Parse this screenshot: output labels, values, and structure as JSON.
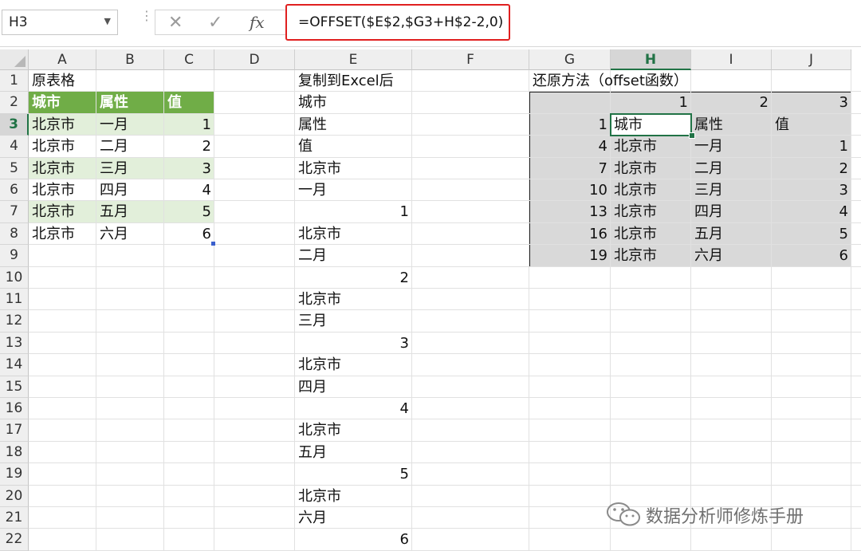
{
  "formula_bar": {
    "name_box": "H3",
    "cancel_icon": "✕",
    "enter_icon": "✓",
    "fx_label": "fx",
    "formula": "=OFFSET($E$2,$G3+H$2-2,0)"
  },
  "columns": [
    "A",
    "B",
    "C",
    "D",
    "E",
    "F",
    "G",
    "H",
    "I",
    "J"
  ],
  "rows": [
    "1",
    "2",
    "3",
    "4",
    "5",
    "6",
    "7",
    "8",
    "9",
    "10",
    "11",
    "12",
    "13",
    "14",
    "15",
    "16",
    "17",
    "18",
    "19",
    "20",
    "21",
    "22"
  ],
  "sheet": {
    "A1": "原表格",
    "A2": "城市",
    "B2": "属性",
    "C2": "值",
    "A3": "北京市",
    "B3": "一月",
    "C3": "1",
    "A4": "北京市",
    "B4": "二月",
    "C4": "2",
    "A5": "北京市",
    "B5": "三月",
    "C5": "3",
    "A6": "北京市",
    "B6": "四月",
    "C6": "4",
    "A7": "北京市",
    "B7": "五月",
    "C7": "5",
    "A8": "北京市",
    "B8": "六月",
    "C8": "6",
    "E1": "复制到Excel后",
    "E2": "城市",
    "E3": "属性",
    "E4": "值",
    "E5": "北京市",
    "E6": "一月",
    "E7": "1",
    "E8": "北京市",
    "E9": "二月",
    "E10": "2",
    "E11": "北京市",
    "E12": "三月",
    "E13": "3",
    "E14": "北京市",
    "E15": "四月",
    "E16": "4",
    "E17": "北京市",
    "E18": "五月",
    "E19": "5",
    "E20": "北京市",
    "E21": "六月",
    "E22": "6",
    "G1": "还原方法（offset函数）",
    "H2": "1",
    "I2": "2",
    "J2": "3",
    "G3": "1",
    "H3": "城市",
    "I3": "属性",
    "J3": "值",
    "G4": "4",
    "H4": "北京市",
    "I4": "一月",
    "J4": "1",
    "G5": "7",
    "H5": "北京市",
    "I5": "二月",
    "J5": "2",
    "G6": "10",
    "H6": "北京市",
    "I6": "三月",
    "J6": "3",
    "G7": "13",
    "H7": "北京市",
    "I7": "四月",
    "J7": "4",
    "G8": "16",
    "H8": "北京市",
    "I8": "五月",
    "J8": "5",
    "G9": "19",
    "H9": "北京市",
    "I9": "六月",
    "J9": "6"
  },
  "active_cell": "H3",
  "colors": {
    "header_green": "#70ad47",
    "band_green": "#e2efda",
    "range_gray": "#d9d9d9",
    "formula_highlight": "#e02020",
    "selection": "#217346"
  },
  "watermark": {
    "icon": "wechat-icon",
    "text": "数据分析师修炼手册"
  }
}
